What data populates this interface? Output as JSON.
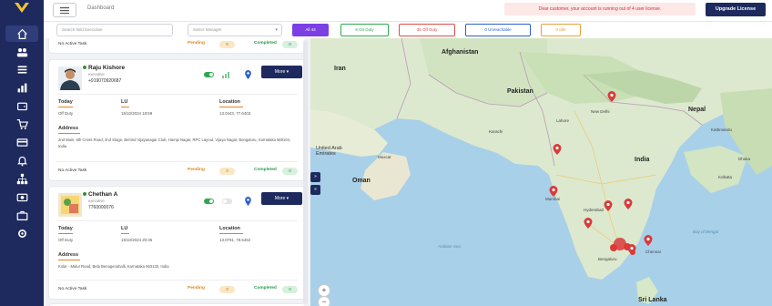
{
  "header": {
    "breadcrumb": "Dashboard",
    "warning": "Dear customer, your account is running out of 4 user license.",
    "upgrade_label": "Upgrade License"
  },
  "filters": {
    "search_placeholder": "Search field Executive",
    "manager_placeholder": "Select Manager",
    "chips": [
      {
        "label": "All 43",
        "color": "#7b3fe4",
        "filled": true
      },
      {
        "label": "8 On Duty",
        "color": "#2ea850",
        "filled": false
      },
      {
        "label": "35 Off Duty",
        "color": "#e04b4b",
        "filled": false
      },
      {
        "label": "0 Unreachable",
        "color": "#2d5fd0",
        "filled": false
      },
      {
        "label": "0 Idle",
        "color": "#e8a03a",
        "filled": false
      }
    ]
  },
  "executives": [
    {
      "name": "Raju Kishore",
      "role": "executive",
      "phone": "+919070920687",
      "more_label": "More",
      "today_label": "Today",
      "today_value": "Off Duty",
      "lu_label": "LU",
      "lu_value": "15/10/2024 18:59",
      "location_label": "Location",
      "location_value": "13.0443, 77.6403",
      "address_label": "Address",
      "address": "2nd Main, 6th Cross Road, 2nd Stage, Behind Vijayanagar Club, Hampi Nagar, RPC Layout, Vijaya Nagar, Bengaluru, Karnataka 560104, India",
      "footer": {
        "no_task": "No Active Task",
        "pending_label": "Pending",
        "pending_count": "0",
        "completed_label": "Completed",
        "completed_count": "0"
      }
    },
    {
      "name": "Chethan A",
      "role": "executive",
      "phone": "7760000076",
      "more_label": "More",
      "today_label": "Today",
      "today_value": "Off Duty",
      "lu_label": "LU",
      "lu_value": "15/10/2024 20:36",
      "location_label": "Location",
      "location_value": "13.0791, 78.5452",
      "address_label": "Address",
      "address": "Kolar - Malur Road, Bela Benagenahalli, Karnataka 563133, India",
      "footer": {
        "no_task": "No Active Task",
        "pending_label": "Pending",
        "pending_count": "0",
        "completed_label": "Completed",
        "completed_count": "0"
      }
    }
  ],
  "top_card_footer": {
    "no_task": "No Active Task",
    "pending_label": "Pending",
    "pending_count": "0",
    "completed_label": "Completed",
    "completed_count": "0"
  },
  "map": {
    "labels": {
      "iran": "Iran",
      "afghanistan": "Afghanistan",
      "pakistan": "Pakistan",
      "nepal": "Nepal",
      "india": "India",
      "uae": "United Arab Emirates",
      "oman": "Oman",
      "sri_lanka": "Sri Lanka",
      "muscat": "Muscat",
      "new_delhi": "New Delhi",
      "hyderabad": "Hyderabad",
      "bengaluru": "Bengaluru",
      "chennai": "Chennai",
      "mumbai": "Mumbai",
      "karachi": "Karachi",
      "lahore": "Lahore",
      "kathmandu": "Kathmandu",
      "dhaka": "Dhaka",
      "kolkata": "Kolkata",
      "arabian_sea": "Arabian Sea",
      "bay_of_bengal": "Bay of Bengal"
    },
    "controls": [
      "expand-icon",
      "collapse-icon"
    ]
  },
  "colors": {
    "primary": "#1e2a5e",
    "accent": "#7b3fe4",
    "pin": "#d93a3a",
    "land": "#d6e8c8",
    "sea": "#a8d0e8"
  }
}
